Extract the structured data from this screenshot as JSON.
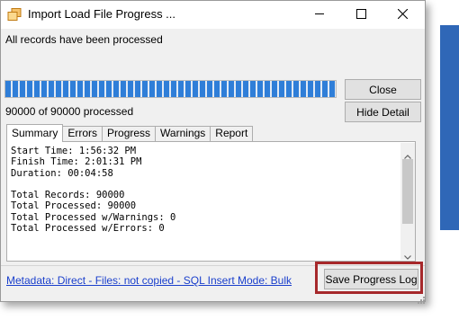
{
  "window": {
    "title": "Import Load File Progress ..."
  },
  "status": {
    "message": "All records have been processed",
    "count_text": "90000 of 90000 processed",
    "progress_fraction": 1.0
  },
  "buttons": {
    "close": "Close",
    "hide_detail": "Hide Detail",
    "save_progress_log": "Save Progress Log"
  },
  "tabs": [
    {
      "label": "Summary",
      "active": true
    },
    {
      "label": "Errors",
      "active": false
    },
    {
      "label": "Progress",
      "active": false
    },
    {
      "label": "Warnings",
      "active": false
    },
    {
      "label": "Report",
      "active": false
    }
  ],
  "summary": {
    "lines": [
      "Start Time: 1:56:32 PM",
      "Finish Time: 2:01:31 PM",
      "Duration: 00:04:58",
      "",
      "Total Records: 90000",
      "Total Processed: 90000",
      "Total Processed w/Warnings: 0",
      "Total Processed w/Errors: 0"
    ]
  },
  "footer": {
    "metadata_link": "Metadata: Direct - Files: not copied - SQL Insert Mode: Bulk"
  },
  "colors": {
    "progress": "#2f7ed8",
    "highlight": "#a6282b",
    "link": "#1a3fcc"
  },
  "icons": {
    "app": "import-app-icon",
    "minimize": "minimize-icon",
    "maximize": "maximize-icon",
    "close": "close-icon"
  }
}
